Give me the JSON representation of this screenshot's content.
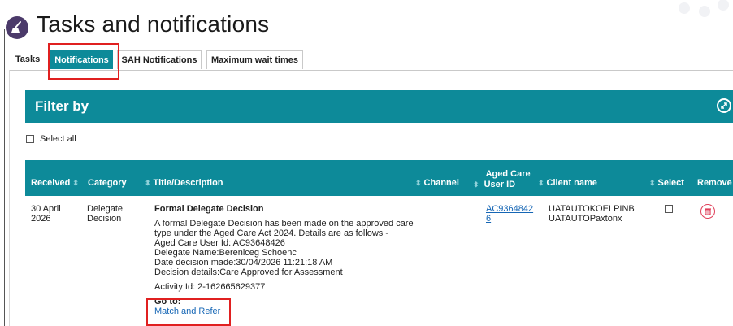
{
  "header": {
    "title": "Tasks and notifications"
  },
  "tabs": [
    {
      "label": "Tasks"
    },
    {
      "label": "Notifications"
    },
    {
      "label": "SAH Notifications"
    },
    {
      "label": "Maximum wait times"
    }
  ],
  "filter": {
    "title": "Filter by",
    "select_all_label": "Select all"
  },
  "table": {
    "columns": {
      "received": "Received",
      "category": "Category",
      "title": "Title/Description",
      "channel": "Channel",
      "aged_care_line1": "Aged Care",
      "aged_care_line2": "User ID",
      "client_name": "Client name",
      "select": "Select",
      "remove": "Remove"
    },
    "rows": [
      {
        "received_line1": "30 April",
        "received_line2": "2026",
        "category_line1": "Delegate",
        "category_line2": "Decision",
        "title": "Formal Delegate Decision",
        "description": [
          "A formal Delegate Decision has been made on the approved care",
          "type under the Aged Care Act 2024. Details are as follows -",
          "Aged Care User Id: AC93648426",
          "Delegate Name:Bereniceg Schoenc",
          "Date decision made:30/04/2026 11:21:18 AM",
          "Decision details:Care Approved for Assessment"
        ],
        "activity": "Activity Id: 2-162665629377",
        "goto_label": "Go to:",
        "goto_link": "Match and Refer",
        "aged_care_id_line1": "AC9364842",
        "aged_care_id_line2": "6",
        "client_line1": "UATAUTOKOELPINB",
        "client_line2": "UATAUTOPaxtonx"
      }
    ]
  },
  "icons": {
    "app": "broom-icon",
    "expand": "expand-icon",
    "remove": "trash-icon"
  },
  "colors": {
    "teal": "#0d8a99",
    "highlight": "#e02020",
    "link": "#1566b5",
    "remove": "#e0405a"
  }
}
